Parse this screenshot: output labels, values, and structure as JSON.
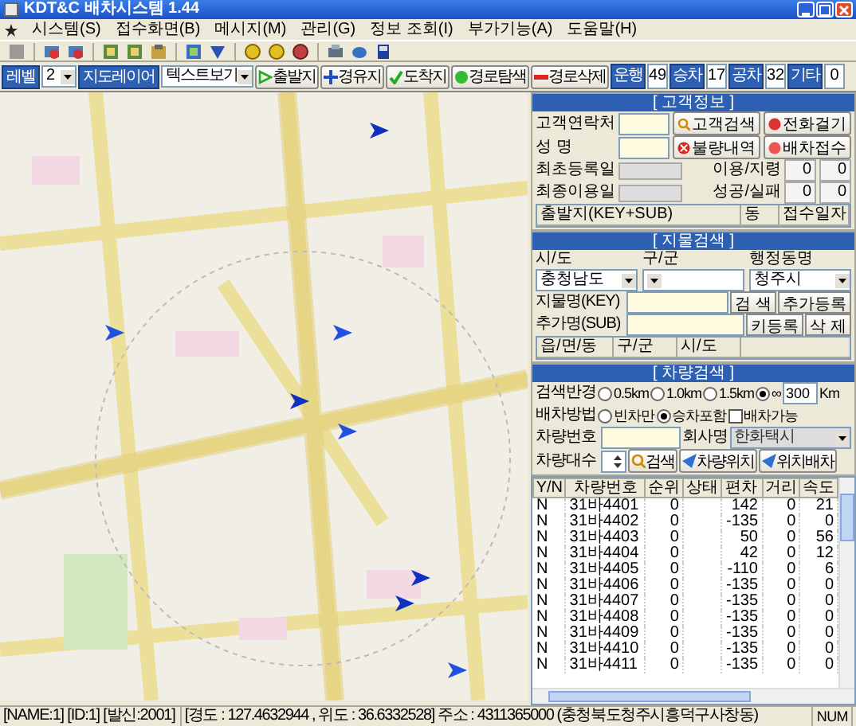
{
  "window": {
    "title": "KDT&C 배차시스템 1.44"
  },
  "menu": [
    {
      "label": "시스템(S)"
    },
    {
      "label": "접수화면(B)"
    },
    {
      "label": "메시지(M)"
    },
    {
      "label": "관리(G)"
    },
    {
      "label": "정보 조회(I)"
    },
    {
      "label": "부가기능(A)"
    },
    {
      "label": "도움말(H)"
    }
  ],
  "toolbar": {
    "level_label": "레벨",
    "level_value": "2",
    "layer_button": "지도레이어",
    "view_select": "텍스트보기",
    "route_buttons": [
      {
        "label": "출발지",
        "kind": "start"
      },
      {
        "label": "경유지",
        "kind": "via"
      },
      {
        "label": "도착지",
        "kind": "end"
      },
      {
        "label": "경로탐색",
        "kind": "search"
      },
      {
        "label": "경로삭제",
        "kind": "delete"
      }
    ],
    "counters": [
      {
        "label": "운행",
        "value": "49"
      },
      {
        "label": "승차",
        "value": "17"
      },
      {
        "label": "공차",
        "value": "32"
      },
      {
        "label": "기타",
        "value": "0"
      }
    ]
  },
  "customer_info": {
    "title": "[ 고객정보 ]",
    "phone_label": "고객연락처",
    "name_label": "성 명",
    "buttons": [
      {
        "label": "고객검색",
        "kind": "search"
      },
      {
        "label": "전화걸기",
        "kind": "phone"
      },
      {
        "label": "불량내역",
        "kind": "bad"
      },
      {
        "label": "배차접수",
        "kind": "dispatch"
      }
    ],
    "stats": [
      {
        "label": "최초등록일",
        "pair_label": "이용/지령",
        "values": [
          "0",
          "0"
        ]
      },
      {
        "label": "최종이용일",
        "pair_label": "성공/실패",
        "values": [
          "0",
          "0"
        ]
      }
    ],
    "list_columns": [
      "출발지(KEY+SUB)",
      "동",
      "접수일자"
    ]
  },
  "landmark_search": {
    "title": "[ 지물검색 ]",
    "selects": [
      {
        "label": "시/도",
        "value": "충청남도"
      },
      {
        "label": "구/군"
      },
      {
        "label": "행정동명",
        "value": "청주시"
      }
    ],
    "fields": [
      {
        "label": "지물명(KEY)",
        "buttons": [
          "검 색",
          "추가등록"
        ]
      },
      {
        "label": "추가명(SUB)",
        "buttons": [
          "키등록",
          "삭 제"
        ]
      }
    ],
    "list_columns": [
      "읍/면/동",
      "구/군",
      "시/도"
    ]
  },
  "vehicle_search": {
    "title": "[ 차량검색 ]",
    "radius_label": "검색반경",
    "radius_options": [
      {
        "label": "0.5km",
        "selected": false
      },
      {
        "label": "1.0km",
        "selected": false
      },
      {
        "label": "1.5km",
        "selected": false
      },
      {
        "label": "∞",
        "selected": true
      }
    ],
    "radius_value": "300",
    "radius_unit": "Km",
    "method_label": "배차방법",
    "method_options": [
      {
        "label": "빈차만",
        "selected": false
      },
      {
        "label": "승차포함",
        "selected": true
      }
    ],
    "dispatchable": {
      "label": "배차가능",
      "checked": false
    },
    "number_label": "차량번호",
    "company_label": "회사명",
    "company_value": "한화택시",
    "count_label": "차량대수",
    "buttons": [
      {
        "label": "검색",
        "kind": "search"
      },
      {
        "label": "차량위치",
        "kind": "locate"
      },
      {
        "label": "위치배차",
        "kind": "dispatch"
      }
    ]
  },
  "vehicle_table": {
    "columns": [
      "Y/N",
      "차량번호",
      "순위",
      "상태",
      "편차",
      "거리",
      "속도"
    ],
    "rows": [
      {
        "yn": "N",
        "number": "31바4401",
        "rank": "0",
        "deviation": "142",
        "distance": "0",
        "speed": "21"
      },
      {
        "yn": "N",
        "number": "31바4402",
        "rank": "0",
        "deviation": "-135",
        "distance": "0",
        "speed": "0"
      },
      {
        "yn": "N",
        "number": "31바4403",
        "rank": "0",
        "deviation": "50",
        "distance": "0",
        "speed": "56"
      },
      {
        "yn": "N",
        "number": "31바4404",
        "rank": "0",
        "deviation": "42",
        "distance": "0",
        "speed": "12"
      },
      {
        "yn": "N",
        "number": "31바4405",
        "rank": "0",
        "deviation": "-110",
        "distance": "0",
        "speed": "6"
      },
      {
        "yn": "N",
        "number": "31바4406",
        "rank": "0",
        "deviation": "-135",
        "distance": "0",
        "speed": "0"
      },
      {
        "yn": "N",
        "number": "31바4407",
        "rank": "0",
        "deviation": "-135",
        "distance": "0",
        "speed": "0"
      },
      {
        "yn": "N",
        "number": "31바4408",
        "rank": "0",
        "deviation": "-135",
        "distance": "0",
        "speed": "0"
      },
      {
        "yn": "N",
        "number": "31바4409",
        "rank": "0",
        "deviation": "-135",
        "distance": "0",
        "speed": "0"
      },
      {
        "yn": "N",
        "number": "31바4410",
        "rank": "0",
        "deviation": "-135",
        "distance": "0",
        "speed": "0"
      },
      {
        "yn": "N",
        "number": "31바4411",
        "rank": "0",
        "deviation": "-135",
        "distance": "0",
        "speed": "0"
      }
    ]
  },
  "status_bar": {
    "sections": [
      "[NAME:1] [ID:1] [발신:2001]",
      "[경도 : 127.4632944 , 위도 : 36.6332528] 주소 : 4311365000 (충청북도청주시흥덕구사창동)",
      "NUM"
    ]
  }
}
